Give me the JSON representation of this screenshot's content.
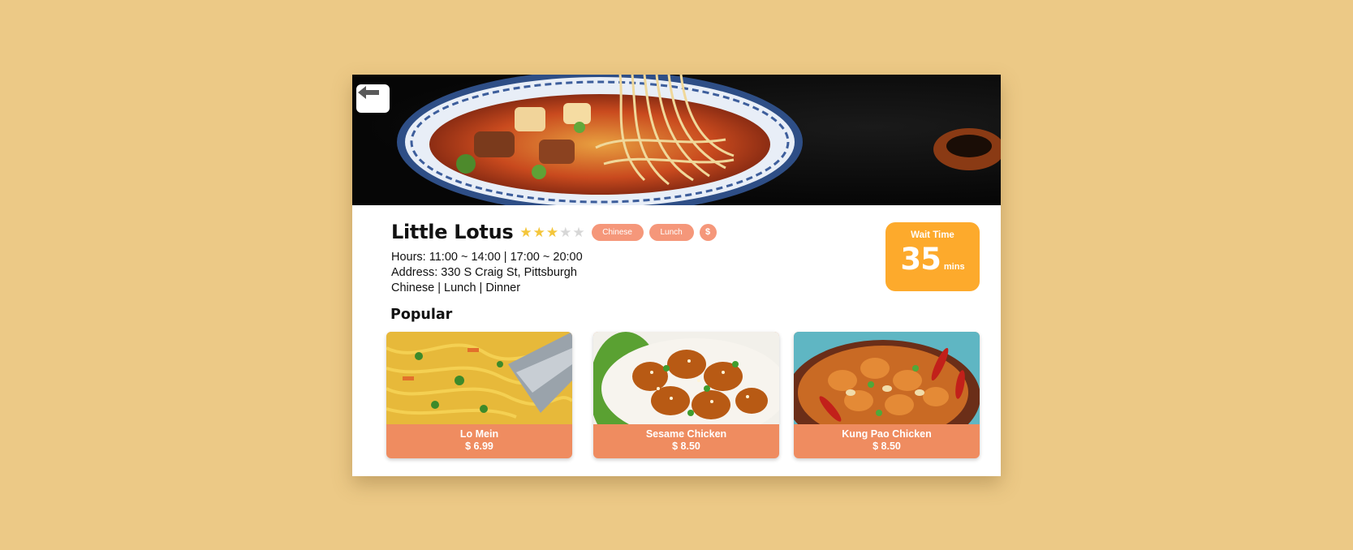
{
  "restaurant": {
    "name": "Little Lotus",
    "rating": 3,
    "rating_max": 5,
    "tags": [
      "Chinese",
      "Lunch"
    ],
    "price_level": "$",
    "hours": "Hours: 11:00 ~ 14:00 | 17:00 ~ 20:00",
    "address": "Address: 330 S Craig St, Pittsburgh",
    "categories": "Chinese | Lunch | Dinner"
  },
  "wait_time": {
    "label": "Wait Time",
    "value": "35",
    "unit": "mins"
  },
  "popular": {
    "title": "Popular",
    "items": [
      {
        "name": "Lo Mein",
        "price": "$ 6.99"
      },
      {
        "name": "Sesame Chicken",
        "price": "$ 8.50"
      },
      {
        "name": "Kung Pao Chicken",
        "price": "$ 8.50"
      }
    ]
  },
  "icons": {
    "back": "arrow-left-icon",
    "star": "star-icon"
  },
  "colors": {
    "background": "#ecc986",
    "tag": "#f5977a",
    "wait_badge": "#fdaa2c",
    "dish_footer": "#ef8c60",
    "star_on": "#f4c63b",
    "star_off": "#d7d7d7"
  }
}
